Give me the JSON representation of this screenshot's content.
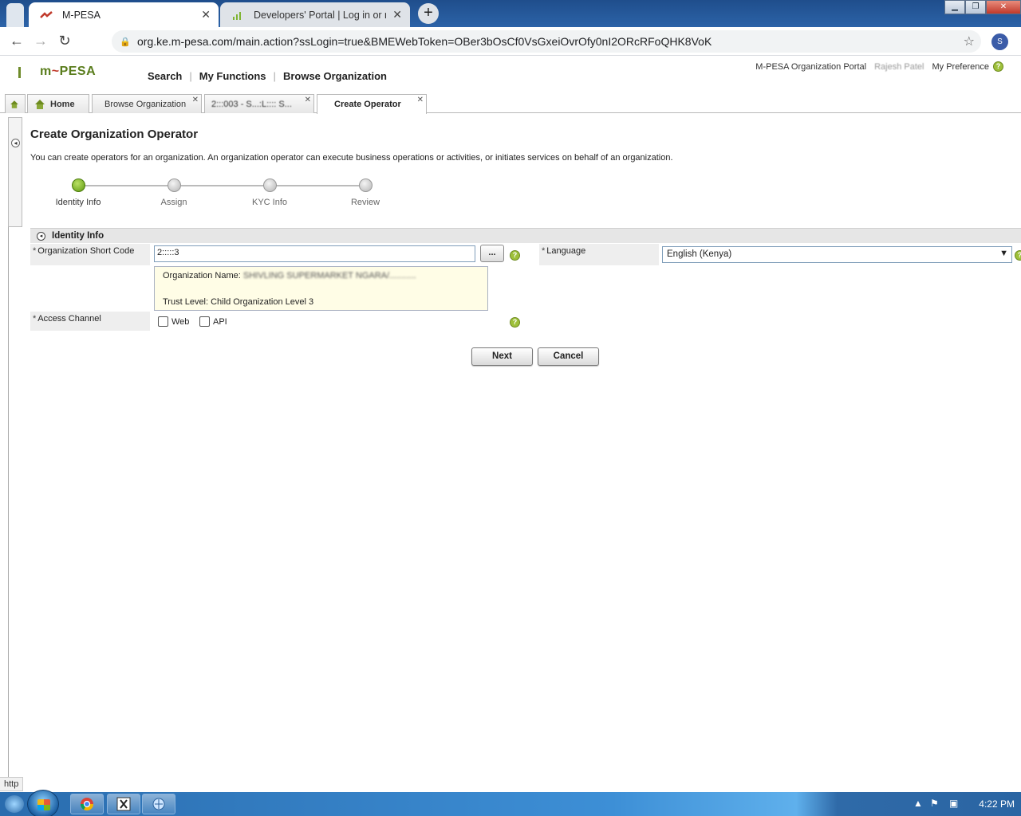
{
  "browser": {
    "tabs": [
      {
        "title": "M-PESA",
        "active": true
      },
      {
        "title": "Developers' Portal | Log in or reg",
        "active": false
      }
    ],
    "new_tab": "+",
    "url": "org.ke.m-pesa.com/main.action?ssLogin=true&BMEWebToken=OBer3bOsCf0VsGxeiOvrOfy0nI2ORcRFoQHK8VoK",
    "profile_initial": "S",
    "close_glyph": "✕"
  },
  "header": {
    "logo": {
      "m": "m",
      "pesa": "PESA"
    },
    "nav": [
      "Search",
      "My Functions",
      "Browse Organization"
    ],
    "portal_name": "M-PESA Organization Portal",
    "user": "Rajesh Patel",
    "preference": "My Preference"
  },
  "app_tabs": [
    {
      "label": "Home"
    },
    {
      "label": "Browse Organization"
    },
    {
      "label": "2:::003 - S...:L:::: S..."
    },
    {
      "label": "Create Operator"
    }
  ],
  "page": {
    "title": "Create Organization Operator",
    "description": "You can create operators for an organization. An organization operator can execute business operations or activities, or initiates services on behalf of an organization."
  },
  "wizard": {
    "steps": [
      "Identity Info",
      "Assign",
      "KYC Info",
      "Review"
    ],
    "current_index": 0
  },
  "form": {
    "section_title": "Identity Info",
    "required_mark": "*",
    "short_code_label": "Organization Short Code",
    "short_code_value": "2:::::3",
    "lookup_button": "...",
    "org_name_label": "Organization Name:",
    "org_name_value": "SHIVLING SUPERMARKET NGARA/...........",
    "trust_level": "Trust Level: Child Organization Level 3",
    "language_label": "Language",
    "language_value": "English (Kenya)",
    "access_channel_label": "Access Channel",
    "channels": [
      "Web",
      "API"
    ],
    "help_glyph": "?"
  },
  "buttons": {
    "next": "Next",
    "cancel": "Cancel"
  },
  "status": {
    "text": "http"
  },
  "taskbar": {
    "time": "4:22 PM"
  },
  "colors": {
    "accent_green": "#6d8a1f",
    "brand_red": "#c0392b",
    "info_box": "#fffde6",
    "taskbar_blue": "#2a6cae"
  }
}
